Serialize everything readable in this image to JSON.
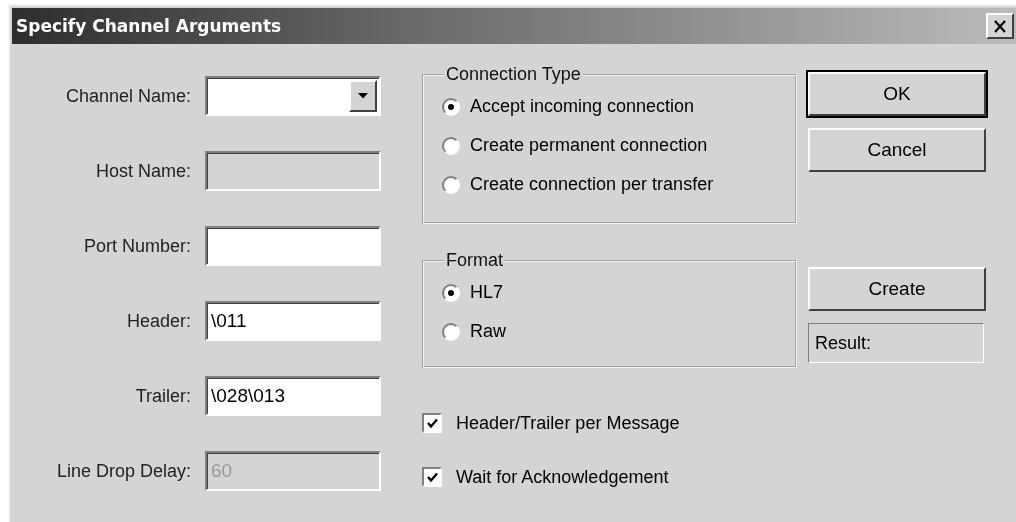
{
  "window": {
    "title": "Specify Channel Arguments"
  },
  "fields": [
    {
      "label": "Channel Name:",
      "kind": "dropdown",
      "disabled": false
    },
    {
      "label": "Host Name:",
      "kind": "text",
      "disabled": true
    },
    {
      "label": "Port Number:",
      "kind": "text",
      "disabled": false
    },
    {
      "label": "Header:",
      "kind": "text",
      "disabled": false,
      "value": "\\011"
    },
    {
      "label": "Trailer:",
      "kind": "text",
      "disabled": false,
      "value": "\\028\\013"
    },
    {
      "label": "Line Drop Delay:",
      "kind": "text",
      "disabled": true,
      "value": "60"
    }
  ],
  "groups": [
    {
      "title": "Connection Type",
      "options": [
        {
          "label": "Accept incoming connection",
          "selected": true
        },
        {
          "label": "Create permanent connection",
          "selected": false
        },
        {
          "label": "Create connection per transfer",
          "selected": false
        }
      ]
    },
    {
      "title": "Format",
      "options": [
        {
          "label": "HL7",
          "selected": true
        },
        {
          "label": "Raw",
          "selected": false
        }
      ]
    }
  ],
  "checkboxes": [
    {
      "label": "Header/Trailer per Message",
      "checked": true
    },
    {
      "label": "Wait for Acknowledgement",
      "checked": true
    }
  ],
  "buttons": [
    {
      "label": "OK",
      "default": true
    },
    {
      "label": "Cancel",
      "default": false
    }
  ],
  "create_button": {
    "label": "Create"
  },
  "result": {
    "text": "Result:"
  }
}
